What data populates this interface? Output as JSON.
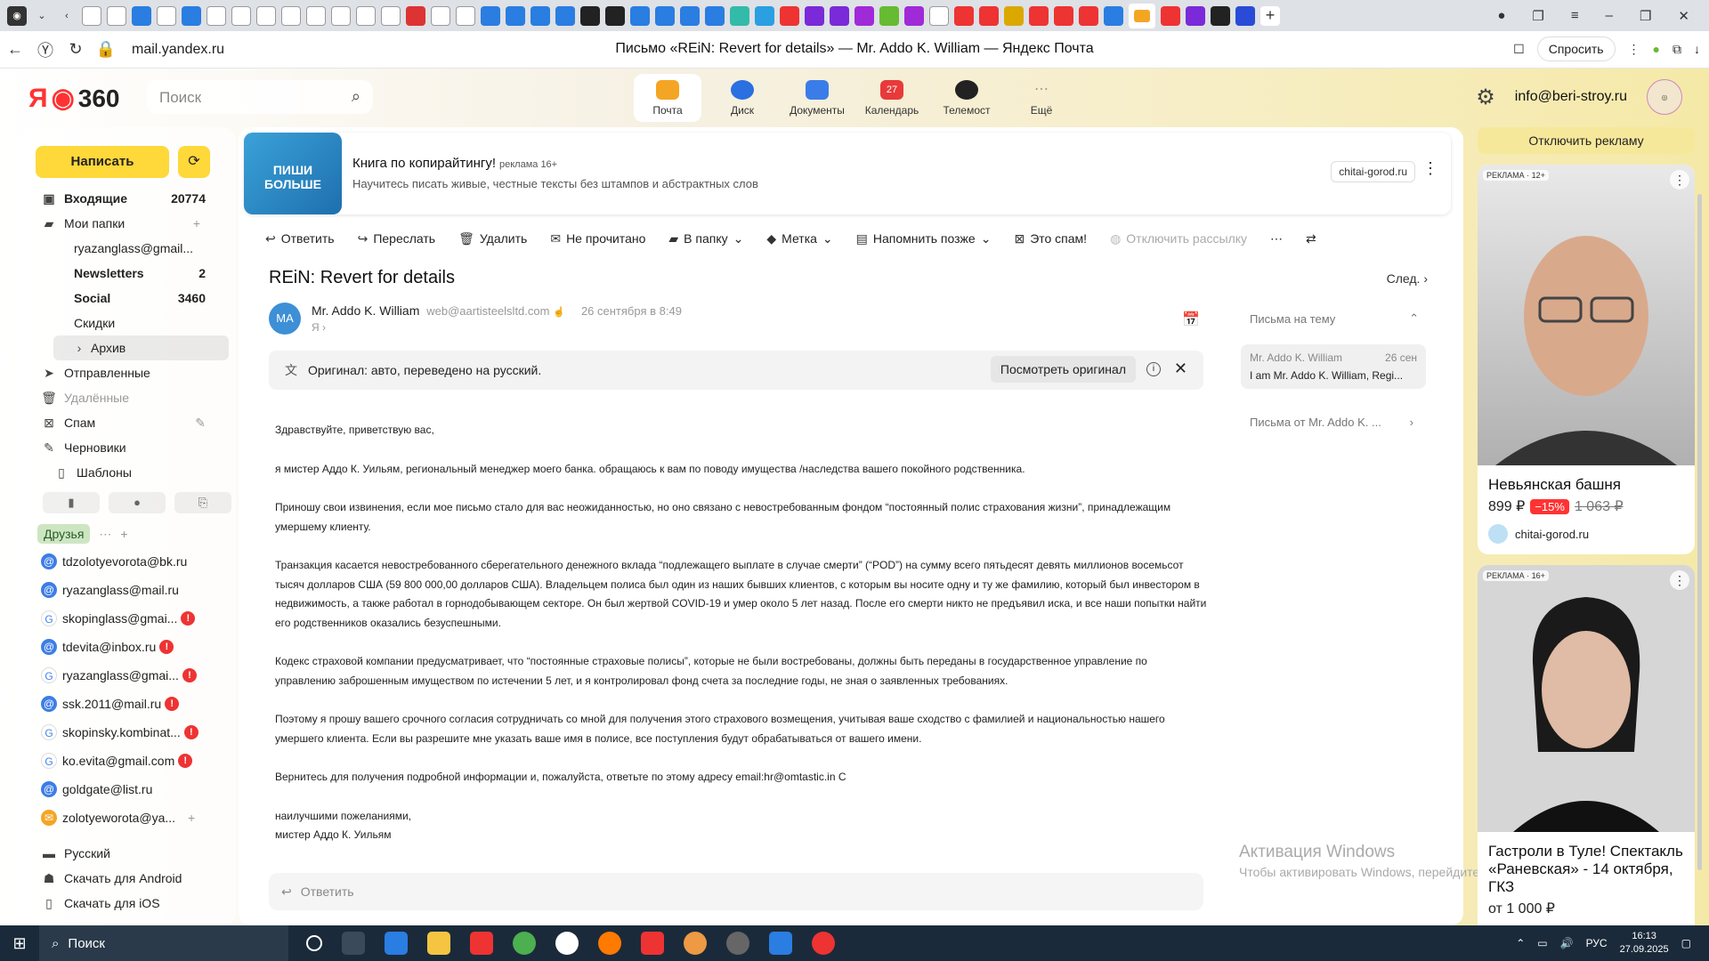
{
  "browser": {
    "url": "mail.yandex.ru",
    "page_title": "Письмо «REiN: Revert for details» — Mr. Addo K. William — Яндекс Почта",
    "ask_label": "Спросить"
  },
  "header": {
    "logo_ya": "Я",
    "logo_360": "360",
    "search_placeholder": "Поиск",
    "services": [
      {
        "label": "Почта",
        "color": "#f5a524"
      },
      {
        "label": "Диск",
        "color": "#2b6fe0"
      },
      {
        "label": "Документы",
        "color": "#3b7de8"
      },
      {
        "label": "Календарь",
        "color": "#e83a3a"
      },
      {
        "label": "Телемост",
        "color": "#222222"
      },
      {
        "label": "Ещё",
        "color": "#bbbbbb"
      }
    ],
    "account": "info@beri-stroy.ru"
  },
  "sidebar": {
    "compose_label": "Написать",
    "folders": [
      {
        "label": "Входящие",
        "count": "20774"
      },
      {
        "label": "Мои папки",
        "count": ""
      },
      {
        "label": "ryazanglass@gmail...",
        "count": ""
      },
      {
        "label": "Newsletters",
        "count": "2"
      },
      {
        "label": "Social",
        "count": "3460"
      },
      {
        "label": "Скидки",
        "count": ""
      },
      {
        "label": "Архив",
        "count": ""
      },
      {
        "label": "Отправленные",
        "count": ""
      },
      {
        "label": "Удалённые",
        "count": ""
      },
      {
        "label": "Спам",
        "count": ""
      },
      {
        "label": "Черновики",
        "count": ""
      },
      {
        "label": "Шаблоны",
        "count": ""
      }
    ],
    "friends_label": "Друзья",
    "contacts": [
      {
        "label": "tdzolotyevorota@bk.ru",
        "warn": ""
      },
      {
        "label": "ryazanglass@mail.ru",
        "warn": ""
      },
      {
        "label": "skopinglass@gmai...",
        "warn": "!"
      },
      {
        "label": "tdevita@inbox.ru",
        "warn": "!"
      },
      {
        "label": "ryazanglass@gmai...",
        "warn": "!"
      },
      {
        "label": "ssk.2011@mail.ru",
        "warn": "!"
      },
      {
        "label": "skopinsky.kombinat...",
        "warn": "!"
      },
      {
        "label": "ko.evita@gmail.com",
        "warn": "!"
      },
      {
        "label": "goldgate@list.ru",
        "warn": ""
      },
      {
        "label": "zolotyeworota@ya...",
        "warn": ""
      }
    ],
    "language": "Русский",
    "android": "Скачать для Android",
    "ios": "Скачать для iOS"
  },
  "ad": {
    "image_text": "ПИШИ БОЛЬШЕ",
    "title": "Книга по копирайтингу!",
    "tag": "реклама  16+",
    "subtitle": "Научитесь писать живые, честные тексты без штампов и абстрактных слов",
    "domain": "chitai-gorod.ru"
  },
  "toolbar": {
    "reply": "Ответить",
    "forward": "Переслать",
    "delete": "Удалить",
    "unread": "Не прочитано",
    "to_folder": "В папку",
    "label": "Метка",
    "remind": "Напомнить позже",
    "spam": "Это спам!",
    "unsubscribe": "Отключить рассылку"
  },
  "message": {
    "subject": "REiN: Revert for details",
    "next": "След.",
    "avatar": "MA",
    "sender_name": "Mr. Addo K. William",
    "sender_email": "web@aartisteelsltd.com",
    "date": "26 сентября в 8:49",
    "to": "Я",
    "translate_text": "Оригинал: авто, переведено на русский.",
    "view_original": "Посмотреть оригинал",
    "body": [
      "Здравствуйте, приветствую вас,",
      "я мистер Аддо К. Уильям, региональный менеджер моего банка. обращаюсь к вам по поводу имущества /наследства вашего покойного родственника.",
      "Приношу свои извинения, если мое письмо стало для вас неожиданностью, но оно связано с невостребованным фондом “постоянный полис страхования жизни”, принадлежащим умершему клиенту.",
      "Транзакция касается невостребованного сберегательного денежного вклада “подлежащего выплате в случае смерти” (“POD”) на сумму всего пятьдесят девять миллионов восемьсот тысяч долларов США (59 800 000,00 долларов США). Владельцем полиса был один из наших бывших клиентов, с которым вы носите одну и ту же фамилию, который был инвестором в недвижимость, а также работал в горнодобывающем секторе. Он был жертвой COVID-19 и умер около 5 лет назад. После его смерти никто не предъявил иска, и все наши попытки найти его родственников оказались безуспешными.",
      "Кодекс страховой компании предусматривает, что “постоянные страховые полисы”, которые не были востребованы, должны быть переданы в государственное управление по управлению заброшенным имуществом по истечении 5 лет, и я контролировал фонд счета за последние годы, не зная о заявленных требованиях.",
      "Поэтому я прошу вашего срочного согласия сотрудничать со мной для получения этого страхового возмещения, учитывая ваше сходство с фамилией и национальностью нашего умершего клиента. Если вы разрешите мне указать ваше имя в полисе, все поступления будут обрабатываться от вашего имени.",
      "Вернитесь для получения подробной информации и, пожалуйста, ответьте по этому адресу email:hr@omtastic.in C"
    ],
    "sign1": "наилучшими пожеланиями,",
    "sign2": "мистер Аддо К. Уильям",
    "reply_placeholder": "Ответить"
  },
  "thread": {
    "header": "Письма на тему",
    "item_sender": "Mr. Addo K. William",
    "item_date": "26 сен",
    "item_preview": "I am Mr. Addo K. William, Regi...",
    "from_link": "Письма от Mr. Addo K. ..."
  },
  "watermark": {
    "title": "Активация Windows",
    "sub": "Чтобы активировать Windows, перейдите в раздел"
  },
  "right_ads": {
    "disable": "Отключить рекламу",
    "card1": {
      "age": "РЕКЛАМА · 12+",
      "title": "Невьянская башня",
      "price": "899 ₽",
      "discount": "−15%",
      "old_price": "1 063 ₽",
      "source": "chitai-gorod.ru"
    },
    "card2": {
      "age": "РЕКЛАМА · 16+",
      "title": "Гастроли в Туле! Спектакль «Раневская» - 14 октября, ГКЗ",
      "price": "от 1 000 ₽"
    }
  },
  "taskbar": {
    "search": "Поиск",
    "lang": "РУС",
    "time": "16:13",
    "date": "27.09.2025"
  }
}
